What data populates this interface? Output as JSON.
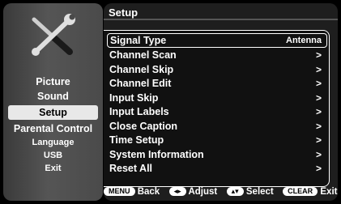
{
  "sidebar": {
    "logo_icon": "tools-icon",
    "items": [
      {
        "label": "Picture",
        "selected": false
      },
      {
        "label": "Sound",
        "selected": false
      },
      {
        "label": "Setup",
        "selected": true
      },
      {
        "label": "Parental Control",
        "selected": false
      },
      {
        "label": "Language",
        "selected": false
      },
      {
        "label": "USB",
        "selected": false
      },
      {
        "label": "Exit",
        "selected": false
      }
    ]
  },
  "main": {
    "title": "Setup",
    "rows": [
      {
        "label": "Signal Type",
        "value": "Antenna"
      },
      {
        "label": "Channel Scan",
        "arrow": ">"
      },
      {
        "label": "Channel Skip",
        "arrow": ">"
      },
      {
        "label": "Channel Edit",
        "arrow": ">"
      },
      {
        "label": "Input Skip",
        "arrow": ">"
      },
      {
        "label": "Input Labels",
        "arrow": ">"
      },
      {
        "label": "Close Caption",
        "arrow": ">"
      },
      {
        "label": "Time Setup",
        "arrow": ">"
      },
      {
        "label": "System Information",
        "arrow": ">"
      },
      {
        "label": "Reset All",
        "arrow": ">"
      }
    ]
  },
  "footer": {
    "menu_key": "MENU",
    "back_label": "Back",
    "adjust_key": "◂▸",
    "adjust_label": "Adjust",
    "select_key": "▴▾",
    "select_label": "Select",
    "clear_key": "CLEAR",
    "exit_label": "Exit"
  },
  "colors": {
    "background": "#000000",
    "panel": "#1e1e1e",
    "text": "#ffffff",
    "selected_bg": "#e8e8e8"
  }
}
